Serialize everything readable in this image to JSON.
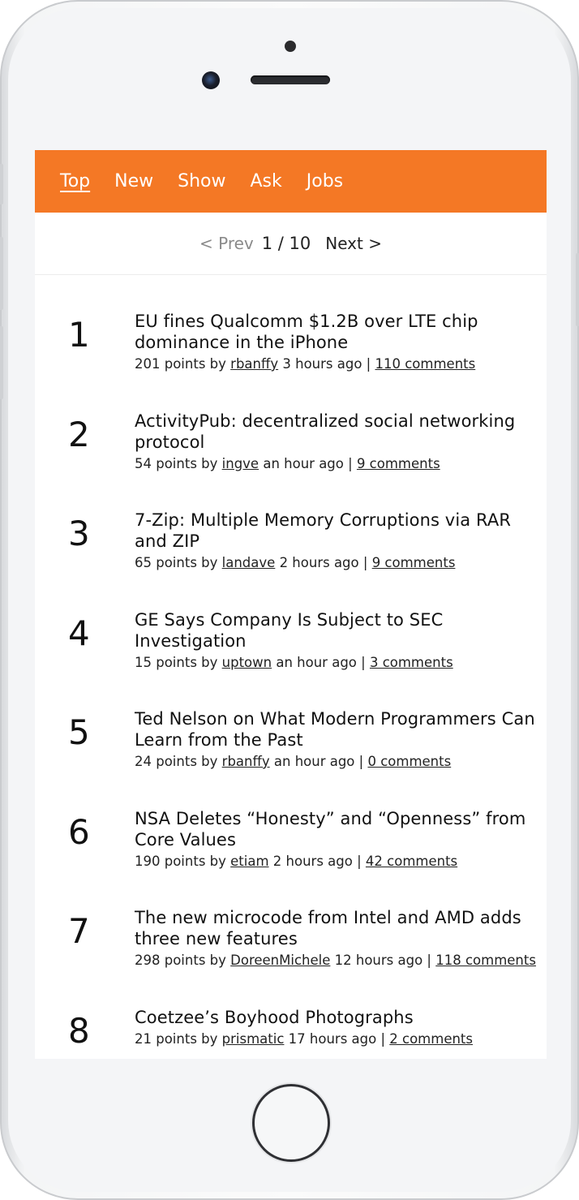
{
  "nav": {
    "items": [
      {
        "label": "Top",
        "active": true
      },
      {
        "label": "New",
        "active": false
      },
      {
        "label": "Show",
        "active": false
      },
      {
        "label": "Ask",
        "active": false
      },
      {
        "label": "Jobs",
        "active": false
      }
    ]
  },
  "pager": {
    "prev_label": "< Prev",
    "page_label": "1 / 10",
    "next_label": "Next >"
  },
  "stories": [
    {
      "rank": "1",
      "title": "EU fines Qualcomm $1.2B over LTE chip dominance in the iPhone",
      "points": "201 points by",
      "user": "rbanffy",
      "age": "3 hours ago |",
      "comments": "110 comments"
    },
    {
      "rank": "2",
      "title": "ActivityPub: decentralized social networking protocol",
      "points": "54 points by",
      "user": "ingve",
      "age": "an hour ago |",
      "comments": "9 comments"
    },
    {
      "rank": "3",
      "title": "7-Zip: Multiple Memory Corruptions via RAR and ZIP",
      "points": "65 points by",
      "user": "landave",
      "age": "2 hours ago |",
      "comments": "9 comments"
    },
    {
      "rank": "4",
      "title": "GE Says Company Is Subject to SEC Investigation",
      "points": "15 points by",
      "user": "uptown",
      "age": "an hour ago |",
      "comments": "3 comments"
    },
    {
      "rank": "5",
      "title": "Ted Nelson on What Modern Programmers Can Learn from the Past",
      "points": "24 points by",
      "user": "rbanffy",
      "age": "an hour ago |",
      "comments": "0 comments"
    },
    {
      "rank": "6",
      "title": "NSA Deletes “Honesty” and “Openness” from Core Values",
      "points": "190 points by",
      "user": "etiam",
      "age": "2 hours ago |",
      "comments": "42 comments"
    },
    {
      "rank": "7",
      "title": "The new microcode from Intel and AMD adds three new features",
      "points": "298 points by",
      "user": "DoreenMichele",
      "age": "12 hours ago |",
      "comments": "118 comments"
    },
    {
      "rank": "8",
      "title": "Coetzee’s Boyhood Photographs",
      "points": "21 points by",
      "user": "prismatic",
      "age": "17 hours ago |",
      "comments": "2 comments"
    }
  ],
  "colors": {
    "header_bg": "#f47825",
    "header_text": "#ffffff",
    "device_frame": "#f4f5f7"
  }
}
